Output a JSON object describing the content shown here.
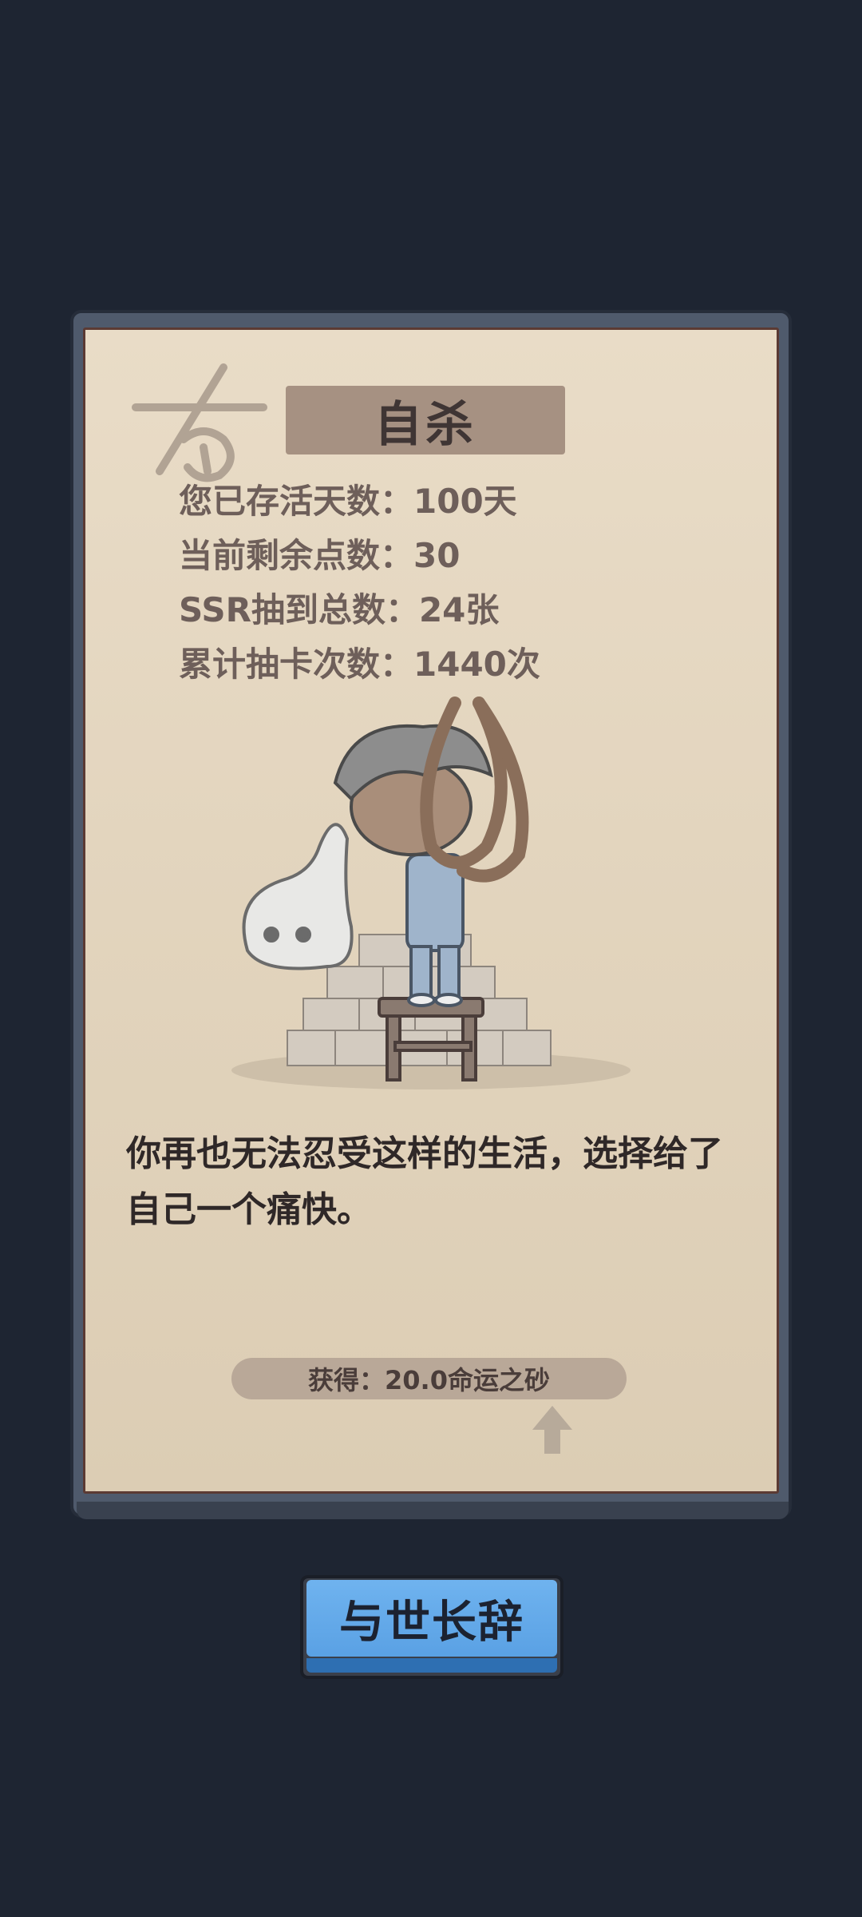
{
  "card": {
    "title": "自杀",
    "stats": [
      "您已存活天数：100天",
      "当前剩余点数：30",
      "SSR抽到总数：24张",
      "累计抽卡次数：1440次"
    ],
    "description": "你再也无法忍受这样的生活，选择给了自己一个痛快。",
    "reward": "获得：20.0命运之砂"
  },
  "action_button": {
    "label": "与世长辞"
  },
  "colors": {
    "background": "#1e2532",
    "paper": "#e2d4bd",
    "button": "#5aa1e4"
  }
}
